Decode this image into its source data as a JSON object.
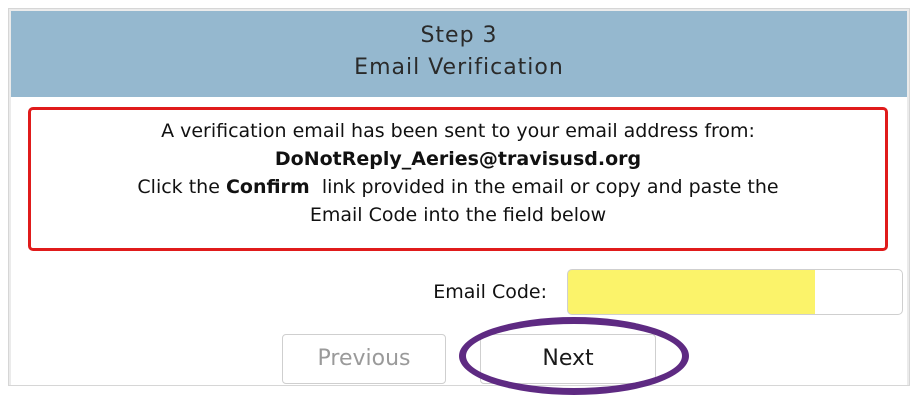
{
  "header": {
    "step": "Step 3",
    "title": "Email Verification"
  },
  "alert": {
    "line1": "A verification email has been sent to your email address from:",
    "sender": "DoNotReply_Aeries@travisusd.org",
    "line3_prefix": "Click the",
    "line3_bold": "Confirm",
    "line3_suffix": "link provided in the email or copy and paste the",
    "line4": "Email Code into the field below",
    "border_color": "#e01b1b"
  },
  "email_code": {
    "label": "Email Code:",
    "value": "",
    "highlight_color": "#fbf36a"
  },
  "buttons": {
    "previous_label": "Previous",
    "next_label": "Next"
  },
  "annotation": {
    "ring_color": "#5e2a82"
  }
}
